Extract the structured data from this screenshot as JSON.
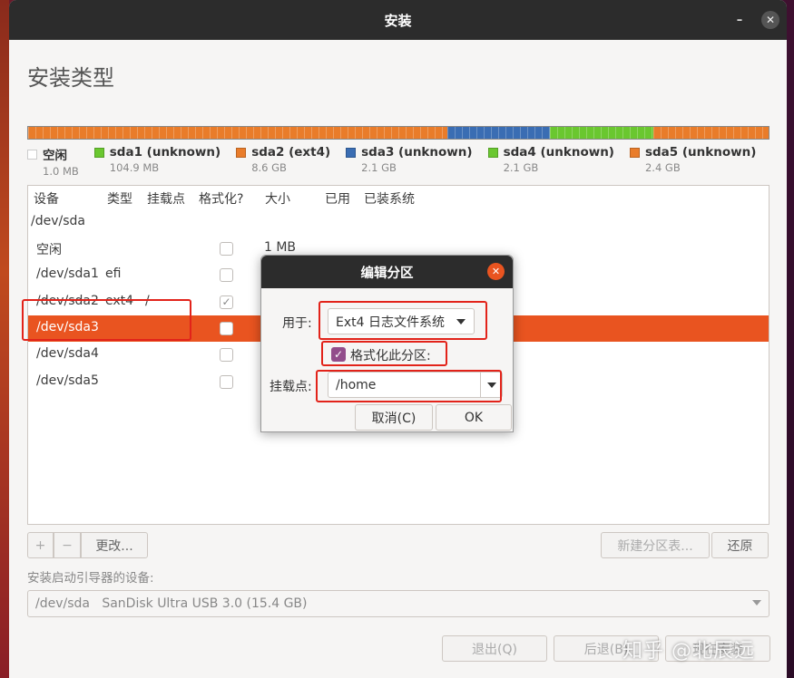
{
  "window": {
    "title": "安装",
    "minimize_glyph": "–",
    "close_glyph": "✕"
  },
  "page": {
    "heading": "安装类型"
  },
  "partition_bar": [
    {
      "color": "#e97c2a",
      "fraction": 0.566
    },
    {
      "color": "#3a6db3",
      "fraction": 0.139
    },
    {
      "color": "#6ac72f",
      "fraction": 0.139
    },
    {
      "color": "#e97c2a",
      "fraction": 0.156
    }
  ],
  "legend": [
    {
      "name": "空闲",
      "size": "1.0 MB",
      "color": "#ffffff"
    },
    {
      "name": "sda1 (unknown)",
      "size": "104.9 MB",
      "color": "#6ac72f"
    },
    {
      "name": "sda2 (ext4)",
      "size": "8.6 GB",
      "color": "#e97c2a"
    },
    {
      "name": "sda3 (unknown)",
      "size": "2.1 GB",
      "color": "#3a6db3"
    },
    {
      "name": "sda4 (unknown)",
      "size": "2.1 GB",
      "color": "#6ac72f"
    },
    {
      "name": "sda5 (unknown)",
      "size": "2.4 GB",
      "color": "#e97c2a"
    }
  ],
  "table": {
    "headers": [
      "设备",
      "类型",
      "挂载点",
      "格式化?",
      "大小",
      "已用",
      "已装系统"
    ],
    "disk": "/dev/sda",
    "rows": [
      {
        "device": "空闲",
        "type": "",
        "mount": "",
        "format": "unchecked",
        "size": "1 MB"
      },
      {
        "device": "/dev/sda1",
        "type": "efi",
        "mount": "",
        "format": "unchecked",
        "size": ""
      },
      {
        "device": "/dev/sda2",
        "type": "ext4",
        "mount": "/",
        "format": "checked",
        "size": ""
      },
      {
        "device": "/dev/sda3",
        "type": "",
        "mount": "",
        "format": "unchecked",
        "size": "",
        "selected": true
      },
      {
        "device": "/dev/sda4",
        "type": "",
        "mount": "",
        "format": "unchecked",
        "size": ""
      },
      {
        "device": "/dev/sda5",
        "type": "",
        "mount": "",
        "format": "unchecked",
        "size": ""
      }
    ]
  },
  "buttons": {
    "add": "+",
    "remove": "−",
    "change": "更改...",
    "new_table": "新建分区表...",
    "revert": "还原"
  },
  "boot": {
    "label": "安装启动引导器的设备:",
    "value": "/dev/sda   SanDisk Ultra USB 3.0 (15.4 GB)"
  },
  "nav": {
    "quit": "退出(Q)",
    "back": "后退(B)",
    "install": "现在安装"
  },
  "watermark": "知乎 @北辰远",
  "dialog": {
    "title": "编辑分区",
    "use_as_label": "用于:",
    "use_as_value": "Ext4 日志文件系统",
    "format_label": "格式化此分区:",
    "format_checked": true,
    "mount_label": "挂载点:",
    "mount_value": "/home",
    "cancel": "取消(C)",
    "ok": "OK"
  },
  "colors": {
    "accent": "#e95420",
    "annotation": "#e2231a",
    "checkbox": "#924d8b"
  }
}
